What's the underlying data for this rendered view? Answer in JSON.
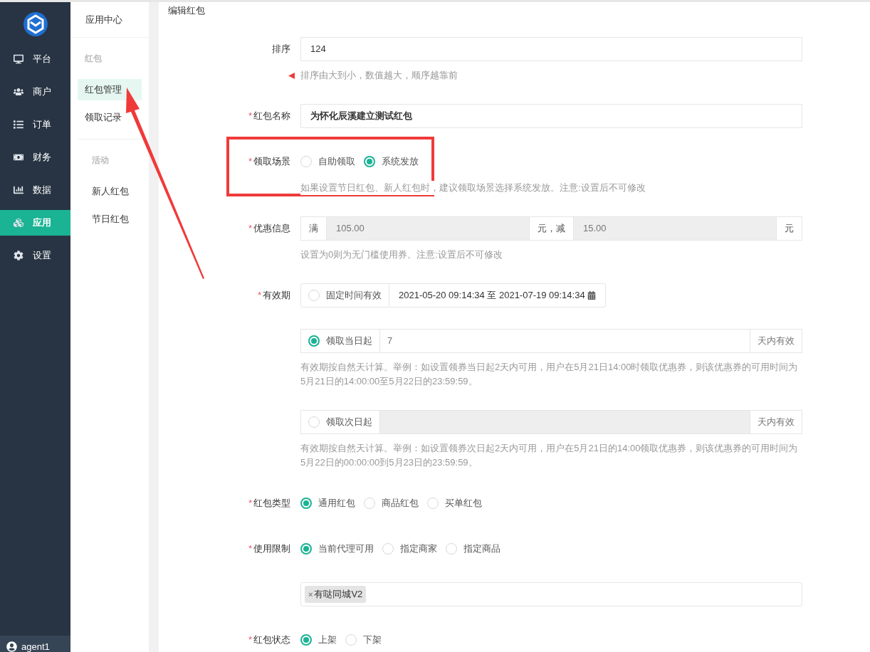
{
  "sidebar": {
    "items": [
      {
        "label": "平台",
        "selected": false
      },
      {
        "label": "商户",
        "selected": false
      },
      {
        "label": "订单",
        "selected": false
      },
      {
        "label": "财务",
        "selected": false
      },
      {
        "label": "数据",
        "selected": false
      },
      {
        "label": "应用",
        "selected": true
      },
      {
        "label": "设置",
        "selected": false
      }
    ],
    "user": "agent1"
  },
  "submenu": {
    "title": "应用中心",
    "groups": [
      {
        "title": "红包",
        "items": [
          {
            "label": "红包管理",
            "selected": true
          },
          {
            "label": "领取记录",
            "selected": false
          }
        ]
      },
      {
        "title": "活动",
        "items": [
          {
            "label": "新人红包",
            "selected": false
          },
          {
            "label": "节日红包",
            "selected": false
          }
        ]
      }
    ]
  },
  "page_title": "编辑红包",
  "fields": [
    {
      "kind": "text",
      "label": "排序",
      "value": "124",
      "bold": false,
      "hint": "排序由大到小，数值越大，顺序越靠前",
      "marker": true
    },
    {
      "kind": "text",
      "required_mark": "*",
      "label": "红包名称",
      "value": "为怀化辰溪建立测试红包",
      "bold": true
    },
    {
      "kind": "radio",
      "required_mark": "*",
      "label": "领取场景",
      "highlighted": true,
      "options": [
        {
          "label": "自助领取",
          "selected": false
        },
        {
          "label": "系统发放",
          "selected": true
        }
      ],
      "hint": "如果设置节日红包、新人红包时，建议领取场景选择系统发放。注意:设置后不可修改"
    },
    {
      "kind": "discount",
      "required_mark": "*",
      "label": "优惠信息",
      "prefix": "满",
      "value": "105.00",
      "middle": "元，减",
      "value2": "15.00",
      "suffix": "元",
      "disabled": true,
      "hint": "设置为0则为无门槛使用券。注意:设置后不可修改"
    },
    {
      "kind": "validity",
      "required_mark": "*",
      "label": "有效期",
      "options": [
        {
          "kind": "range",
          "label": "固定时间有效",
          "selected": false,
          "value": "2021-05-20 09:14:34 至 2021-07-19 09:14:34"
        },
        {
          "kind": "days",
          "label": "领取当日起",
          "selected": true,
          "value": "7",
          "suffix": "天内有效",
          "disabled": false,
          "hint": "有效期按自然天计算。举例：如设置领券当日起2天内可用，用户在5月21日14:00时领取优惠券，则该优惠券的可用时间为5月21日的14:00:00至5月22日的23:59:59。"
        },
        {
          "kind": "days",
          "label": "领取次日起",
          "selected": false,
          "suffix": "天内有效",
          "disabled": true,
          "hint": "有效期按自然天计算。举例：如设置领券次日起2天内可用，用户在5月21日的14:00领取优惠券，则该优惠券的可用时间为5月22日的00:00:00到5月23日的23:59:59。"
        }
      ]
    },
    {
      "kind": "radio",
      "required_mark": "*",
      "label": "红包类型",
      "options": [
        {
          "label": "通用红包",
          "selected": true
        },
        {
          "label": "商品红包",
          "selected": false
        },
        {
          "label": "买单红包",
          "selected": false
        }
      ]
    },
    {
      "kind": "radio",
      "required_mark": "*",
      "label": "使用限制",
      "options": [
        {
          "label": "当前代理可用",
          "selected": true
        },
        {
          "label": "指定商家",
          "selected": false
        },
        {
          "label": "指定商品",
          "selected": false
        }
      ]
    },
    {
      "kind": "tags",
      "tags": [
        {
          "remove": "×",
          "label": "有哒同城V2"
        }
      ]
    },
    {
      "kind": "radio",
      "required_mark": "*",
      "label": "红包状态",
      "options": [
        {
          "label": "上架",
          "selected": true
        },
        {
          "label": "下架",
          "selected": false
        }
      ]
    }
  ]
}
